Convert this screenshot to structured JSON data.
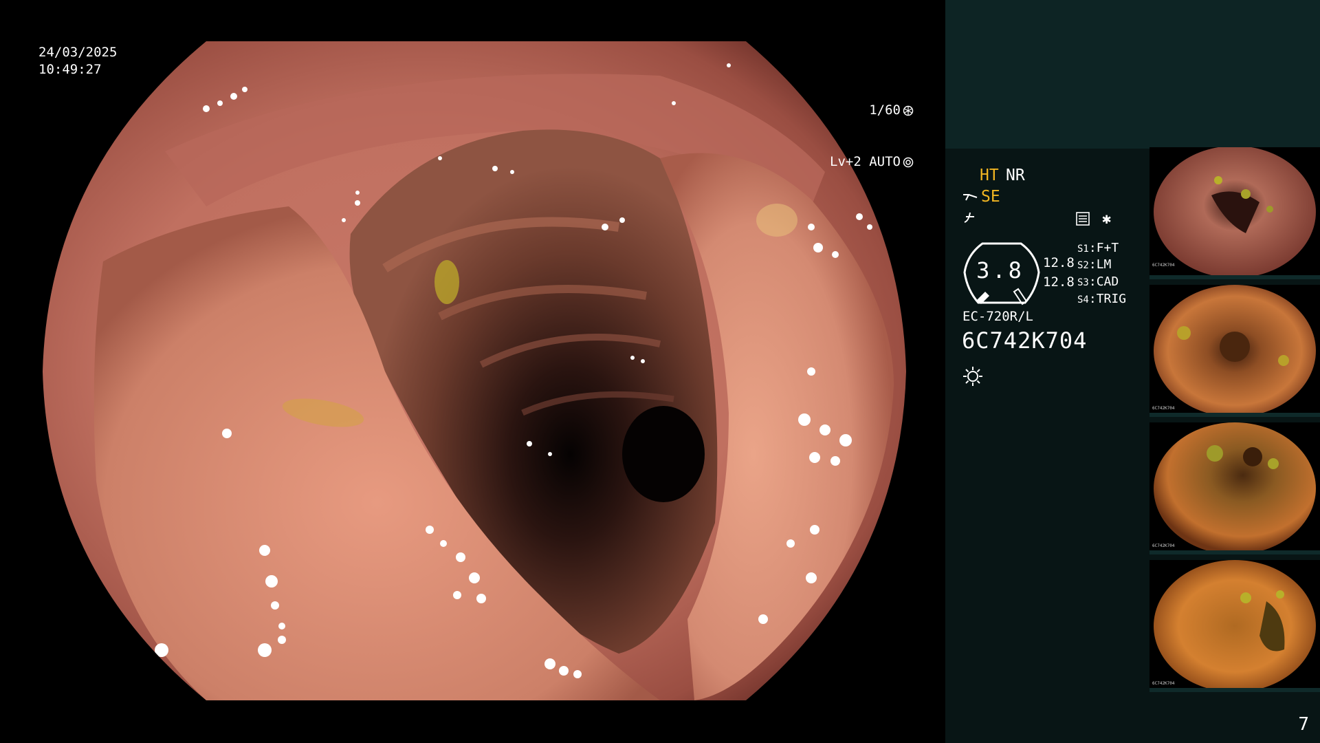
{
  "main_view": {
    "date": "24/03/2025",
    "time": "10:49:27",
    "shutter": "1/60",
    "level": "Lv+2 AUTO"
  },
  "panel": {
    "mode_ht": "HT",
    "mode_nr": "NR",
    "mode_se": "SE",
    "zoom_value": "3.8",
    "val_1": "12.8",
    "val_2": "12.8",
    "scope_keys": [
      {
        "key": "S1",
        "label": "F+T"
      },
      {
        "key": "S2",
        "label": "LM"
      },
      {
        "key": "S3",
        "label": "CAD"
      },
      {
        "key": "S4",
        "label": "TRIG"
      }
    ],
    "scope_model": "EC-720R/L",
    "serial": "6C742K704",
    "page_number": "7"
  },
  "thumbnails": [
    {
      "label": "6C742K704"
    },
    {
      "label": "6C742K704"
    },
    {
      "label": "6C742K704"
    },
    {
      "label": "6C742K704"
    }
  ],
  "colors": {
    "mode_highlight": "#f2b622",
    "panel_bg": "#081515",
    "panel_top_bg": "#0d2424"
  }
}
